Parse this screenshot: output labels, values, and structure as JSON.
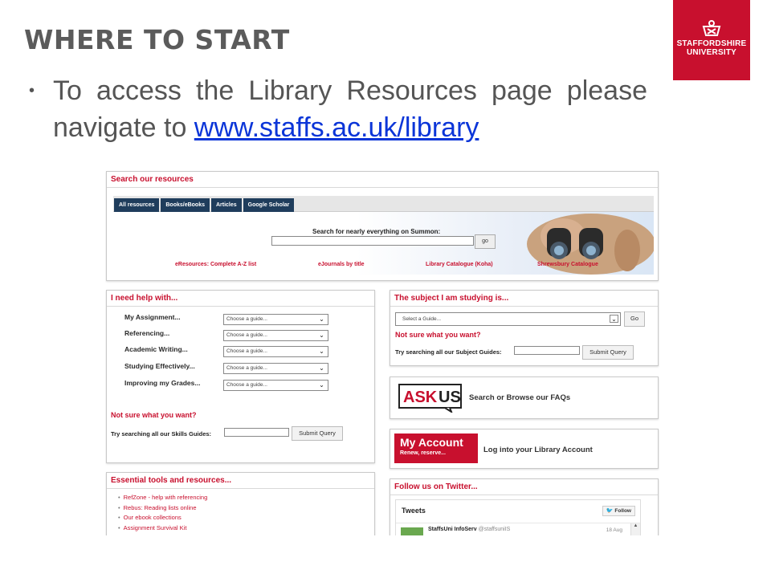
{
  "slide": {
    "title": "WHERE TO START",
    "logo_line1": "STAFFORDSHIRE",
    "logo_line2": "UNIVERSITY",
    "bullet_text": "To access the Library Resources page please navigate to ",
    "bullet_link": "www.staffs.ac.uk/library"
  },
  "search": {
    "title": "Search our resources",
    "tabs": [
      "All resources",
      "Books/eBooks",
      "Articles",
      "Google Scholar"
    ],
    "summon_label": "Search for nearly everything on Summon:",
    "go_label": "go",
    "links": [
      "eResources: Complete A-Z list",
      "eJournals by title",
      "Library Catalogue (Koha)",
      "Shrewsbury Catalogue"
    ]
  },
  "help": {
    "title": "I need help with...",
    "rows": [
      {
        "label": "My Assignment...",
        "select": "Choose a guide..."
      },
      {
        "label": "Referencing...",
        "select": "Choose a guide..."
      },
      {
        "label": "Academic Writing...",
        "select": "Choose a guide..."
      },
      {
        "label": "Studying Effectively...",
        "select": "Choose a guide..."
      },
      {
        "label": "Improving my Grades...",
        "select": "Choose a guide..."
      }
    ],
    "not_sure": "Not sure what you want?",
    "try_text": "Try searching all our Skills Guides:",
    "submit_label": "Submit Query"
  },
  "subject": {
    "title": "The subject I am studying is...",
    "select": "Select a Guide...",
    "go_label": "Go",
    "not_sure": "Not sure what you want?",
    "try_text": "Try searching all our Subject Guides:",
    "submit_label": "Submit Query"
  },
  "askus": {
    "logo_text": "ASKUS",
    "text": "Search or Browse our FAQs"
  },
  "account": {
    "logo_line1": "My Account",
    "logo_line2": "Renew, reserve...",
    "text": "Log into your Library Account"
  },
  "tools": {
    "title": "Essential tools and resources...",
    "items": [
      "RefZone - help with referencing",
      "Rebus: Reading lists online",
      "Our ebook collections",
      "Assignment Survival Kit"
    ]
  },
  "twitter": {
    "title": "Follow us on Twitter...",
    "heading": "Tweets",
    "follow_label": "Follow",
    "tweet_name": "StaffsUni InfoServ",
    "tweet_handle": "@staffsuniIS",
    "tweet_date": "18 Aug"
  },
  "colors": {
    "brand_red": "#c8102e",
    "tab_navy": "#1f3d5c",
    "link_blue": "#0b35d8"
  }
}
